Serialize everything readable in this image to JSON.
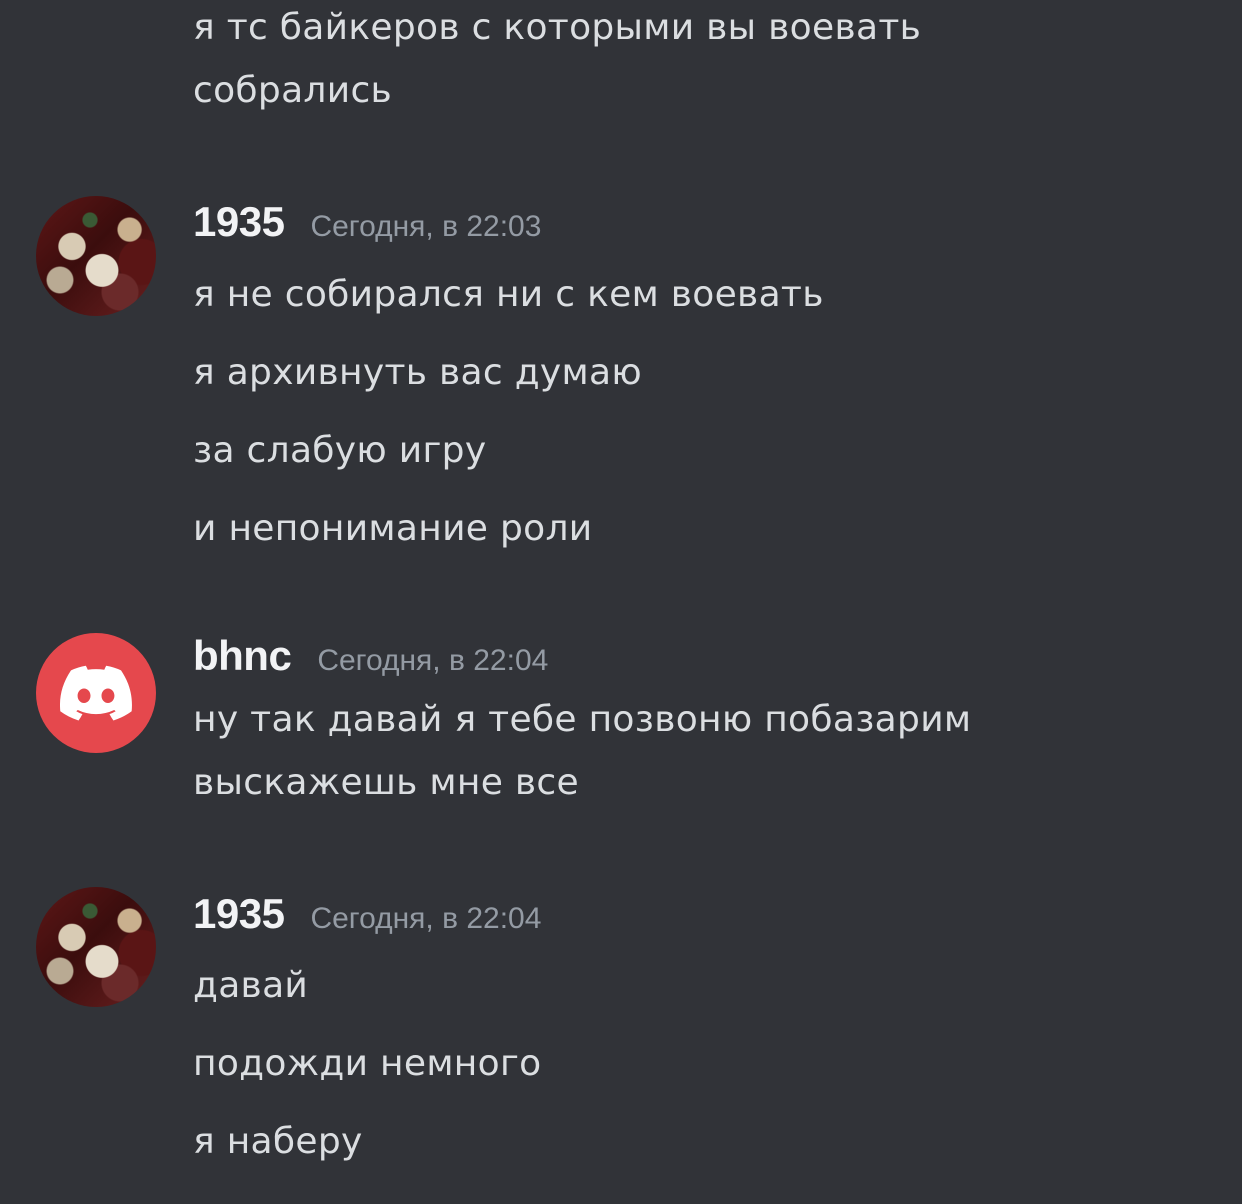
{
  "messages": {
    "prev": {
      "lines": [
        "я тс байкеров с которыми вы воевать",
        "собрались"
      ]
    },
    "group1": {
      "username": "1935",
      "timestamp": "Сегодня, в 22:03",
      "avatar_icon": "user-avatar-image",
      "lines": [
        "я не собирался ни с кем воевать",
        "я архивнуть вас думаю",
        "за слабую игру",
        "и непонимание роли"
      ]
    },
    "group2": {
      "username": "bhnc",
      "timestamp": "Сегодня, в 22:04",
      "avatar_icon": "discord-logo-icon",
      "avatar_color": "#e5484d",
      "lines": [
        "ну так давай я тебе позвоню побазарим",
        "выскажешь мне все"
      ]
    },
    "group3": {
      "username": "1935",
      "timestamp": "Сегодня, в 22:04",
      "avatar_icon": "user-avatar-image",
      "lines": [
        "давай",
        "подожди немного",
        "я наберу"
      ]
    }
  },
  "colors": {
    "background": "#313338",
    "message_text": "#dbdee1",
    "username": "#f2f3f5",
    "timestamp": "#949ba4"
  }
}
